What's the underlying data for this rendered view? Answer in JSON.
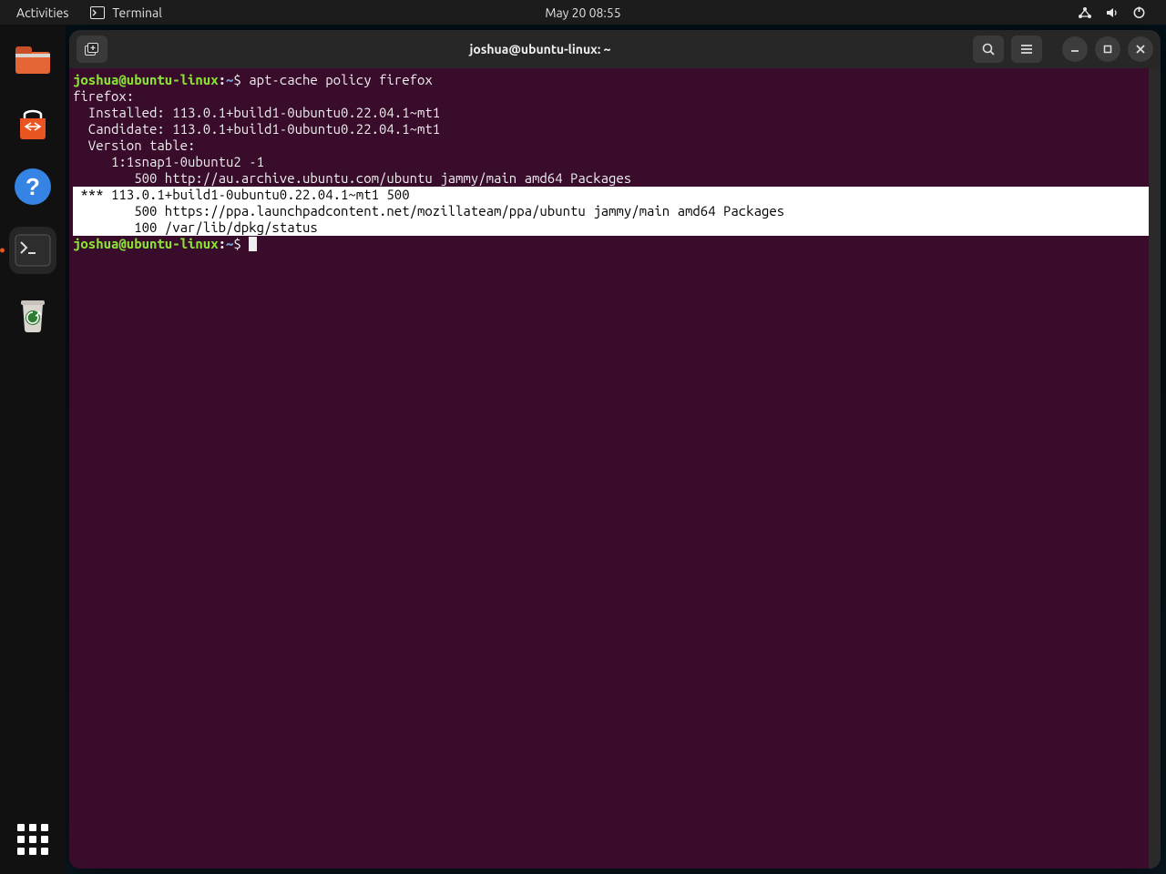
{
  "topbar": {
    "activities": "Activities",
    "appmenu_label": "Terminal",
    "clock": "May 20  08:55"
  },
  "titlebar": {
    "title": "joshua@ubuntu-linux: ~"
  },
  "prompt": {
    "user_host": "joshua@ubuntu-linux",
    "colon": ":",
    "path": "~",
    "dollar": "$"
  },
  "command": " apt-cache policy firefox",
  "output": {
    "l1": "firefox:",
    "l2": "  Installed: 113.0.1+build1-0ubuntu0.22.04.1~mt1",
    "l3": "  Candidate: 113.0.1+build1-0ubuntu0.22.04.1~mt1",
    "l4": "  Version table:",
    "l5": "     1:1snap1-0ubuntu2 -1",
    "l6": "        500 http://au.archive.ubuntu.com/ubuntu jammy/main amd64 Packages",
    "h1": " *** 113.0.1+build1-0ubuntu0.22.04.1~mt1 500",
    "h2": "        500 https://ppa.launchpadcontent.net/mozillateam/ppa/ubuntu jammy/main amd64 Packages",
    "h3": "        100 /var/lib/dpkg/status"
  },
  "dock": {
    "items": [
      {
        "name": "files"
      },
      {
        "name": "software"
      },
      {
        "name": "help"
      },
      {
        "name": "terminal"
      },
      {
        "name": "trash"
      }
    ]
  }
}
